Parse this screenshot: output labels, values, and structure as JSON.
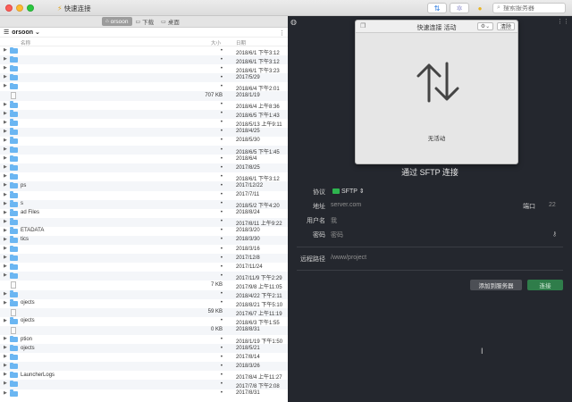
{
  "titlebar": {
    "title": "快速连接",
    "search_placeholder": "搜索服务器"
  },
  "pathbar": {
    "crumbs": [
      {
        "label": "orsoon",
        "active": true
      },
      {
        "label": "下载",
        "active": false
      },
      {
        "label": "桌面",
        "active": false
      }
    ]
  },
  "left_pane": {
    "user": "orsoon",
    "columns": {
      "name": "名称",
      "size": "大小",
      "date": "日期"
    },
    "rows": [
      {
        "type": "folder",
        "name": "",
        "size": "•",
        "date": "2018/6/1 下午3:12"
      },
      {
        "type": "folder",
        "name": "",
        "size": "•",
        "date": "2018/6/1 下午3:12"
      },
      {
        "type": "folder",
        "name": "",
        "size": "•",
        "date": "2018/6/1 下午3:23"
      },
      {
        "type": "folder",
        "name": "",
        "size": "•",
        "date": "2017/5/29"
      },
      {
        "type": "folder",
        "name": "",
        "size": "•",
        "date": "2018/6/4 下午2:01"
      },
      {
        "type": "file",
        "name": "",
        "size": "707 KB",
        "date": "2018/1/19"
      },
      {
        "type": "folder",
        "name": "",
        "size": "•",
        "date": "2018/6/4 上午8:36"
      },
      {
        "type": "folder",
        "name": "",
        "size": "•",
        "date": "2018/6/5 下午1:43"
      },
      {
        "type": "folder",
        "name": "",
        "size": "•",
        "date": "2018/5/13 上午9:11"
      },
      {
        "type": "folder",
        "name": "",
        "size": "•",
        "date": "2018/4/25"
      },
      {
        "type": "folder",
        "name": "",
        "size": "•",
        "date": "2018/5/30"
      },
      {
        "type": "folder",
        "name": "",
        "size": "•",
        "date": "2018/6/5 下午1:45"
      },
      {
        "type": "folder",
        "name": "",
        "size": "•",
        "date": "2018/6/4"
      },
      {
        "type": "folder",
        "name": "",
        "size": "•",
        "date": "2017/8/25"
      },
      {
        "type": "folder",
        "name": "",
        "size": "•",
        "date": "2018/6/1 下午3:12"
      },
      {
        "type": "folder",
        "name": "ps",
        "size": "•",
        "date": "2017/12/22"
      },
      {
        "type": "folder",
        "name": "",
        "size": "•",
        "date": "2017/7/11"
      },
      {
        "type": "folder",
        "name": "s",
        "size": "•",
        "date": "2018/5/2 下午4:20"
      },
      {
        "type": "folder",
        "name": "ad Files",
        "size": "•",
        "date": "2018/8/24"
      },
      {
        "type": "folder",
        "name": "",
        "size": "•",
        "date": "2017/8/11 上午9:22"
      },
      {
        "type": "folder",
        "name": "ETADATA",
        "size": "•",
        "date": "2018/3/20"
      },
      {
        "type": "folder",
        "name": "tics",
        "size": "•",
        "date": "2018/3/30"
      },
      {
        "type": "folder",
        "name": "",
        "size": "•",
        "date": "2018/3/16"
      },
      {
        "type": "folder",
        "name": "",
        "size": "•",
        "date": "2017/12/8"
      },
      {
        "type": "folder",
        "name": "",
        "size": "•",
        "date": "2017/11/24"
      },
      {
        "type": "folder",
        "name": "",
        "size": "•",
        "date": "2017/11/9 下午2:29"
      },
      {
        "type": "file",
        "name": "",
        "size": "7 KB",
        "date": "2017/9/8 上午11:05"
      },
      {
        "type": "folder",
        "name": "",
        "size": "•",
        "date": "2018/4/22 下午2:11"
      },
      {
        "type": "folder",
        "name": "ojects",
        "size": "•",
        "date": "2018/8/21 下午5:10"
      },
      {
        "type": "file",
        "name": "",
        "size": "59 KB",
        "date": "2017/6/7 上午11:19"
      },
      {
        "type": "folder",
        "name": "ojects",
        "size": "•",
        "date": "2018/6/3 下午1:55"
      },
      {
        "type": "file",
        "name": "",
        "size": "0 KB",
        "date": "2018/8/31"
      },
      {
        "type": "folder",
        "name": "ption",
        "size": "•",
        "date": "2018/1/19 下午1:50"
      },
      {
        "type": "folder",
        "name": "ojects",
        "size": "•",
        "date": "2018/5/21"
      },
      {
        "type": "folder",
        "name": "",
        "size": "•",
        "date": "2017/8/14"
      },
      {
        "type": "folder",
        "name": "",
        "size": "•",
        "date": "2018/3/26"
      },
      {
        "type": "folder",
        "name": "LauncherLogs",
        "size": "•",
        "date": "2017/8/4 上午11:27"
      },
      {
        "type": "folder",
        "name": "",
        "size": "•",
        "date": "2017/7/8 下午2:08"
      },
      {
        "type": "folder",
        "name": "",
        "size": "•",
        "date": "2017/8/31"
      }
    ]
  },
  "popup": {
    "title": "快速连接 活动",
    "clear_label": "清除",
    "empty_label": "无活动"
  },
  "connect_form": {
    "title": "通过 SFTP 连接",
    "protocol_label": "协议",
    "protocol_value": "SFTP",
    "address_label": "地址",
    "address_placeholder": "server.com",
    "port_label": "端口",
    "port_value": "22",
    "username_label": "用户名",
    "username_value": "我",
    "password_label": "密码",
    "password_placeholder": "密码",
    "remote_path_label": "远程路径",
    "remote_path_value": "/www/project",
    "add_button": "添加到服务器",
    "connect_button": "连接"
  }
}
